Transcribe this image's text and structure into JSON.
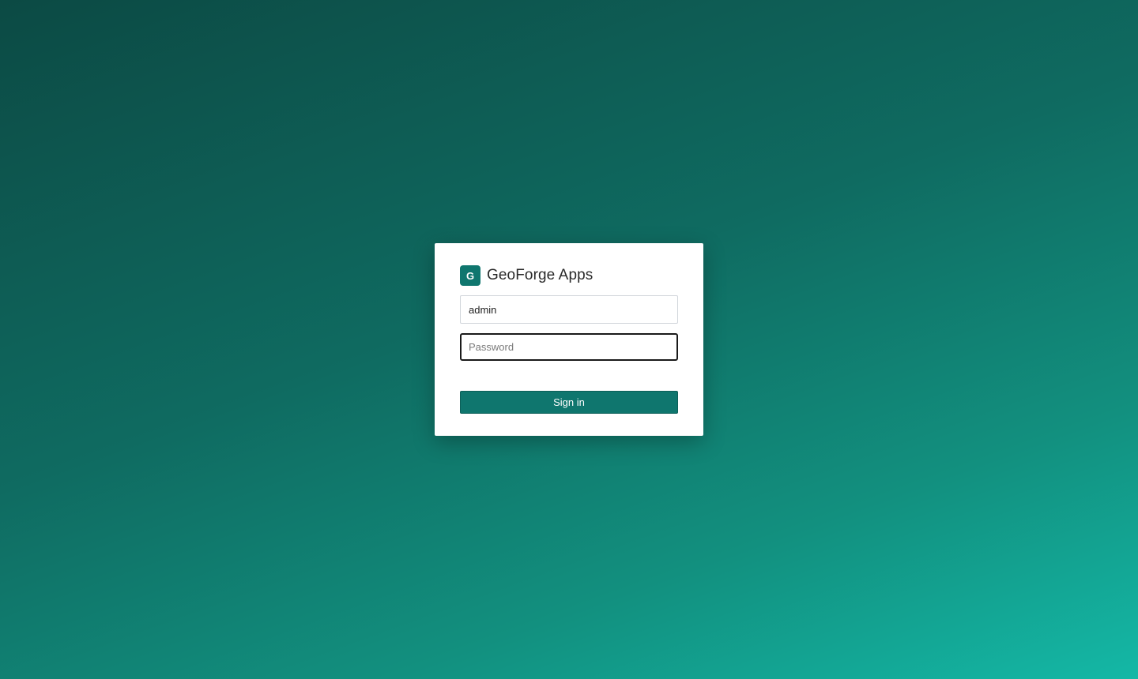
{
  "brand": {
    "logo_letter": "G",
    "name": "GeoForge Apps",
    "accent_color": "#0f766e"
  },
  "login": {
    "username_value": "admin",
    "password_placeholder": "Password",
    "signin_label": "Sign in"
  }
}
